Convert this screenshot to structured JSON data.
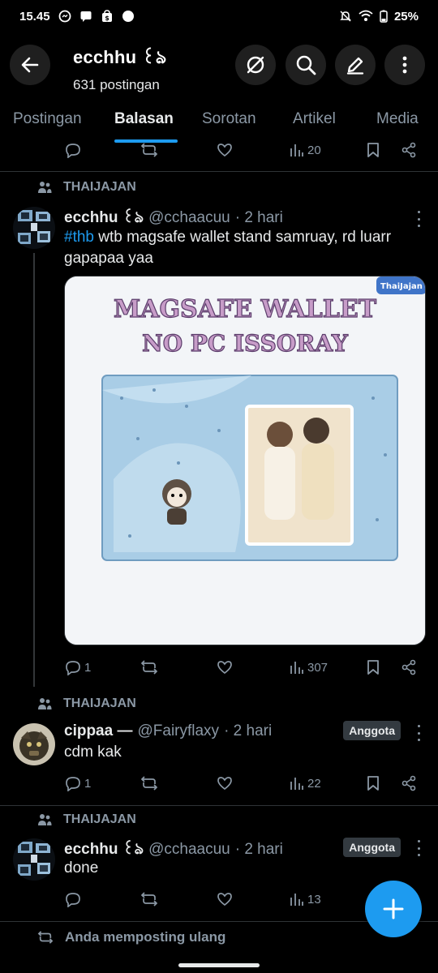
{
  "status_bar": {
    "time": "15.45",
    "battery": "25%"
  },
  "header": {
    "title": "ecchhu ꒰ঌ",
    "subtitle": "631 postingan"
  },
  "tabs": [
    {
      "label": "Postingan"
    },
    {
      "label": "Balasan"
    },
    {
      "label": "Sorotan"
    },
    {
      "label": "Artikel"
    },
    {
      "label": "Media"
    }
  ],
  "active_tab": "Balasan",
  "prev_post_actions": {
    "views": "20"
  },
  "posts": [
    {
      "context": "THAIJAJAN",
      "name": "ecchhu ꒰ঌ",
      "handle": "@cchaacuu",
      "time": "· 2 hari",
      "hashtag": "#thb",
      "text": " wtb magsafe wallet stand samruay, rd luarr gapapaa yaa",
      "media": {
        "title_line1": "MAGSAFE WALLET",
        "title_line2": "NO PC ISSORAY",
        "corner_label": "ThaiJajan"
      },
      "replies": "1",
      "views": "307"
    },
    {
      "context": "THAIJAJAN",
      "name": "cippaa —",
      "handle": "@Fairyflaxy",
      "time": "· 2 hari",
      "badge": "Anggota",
      "text": "cdm kak",
      "replies": "1",
      "views": "22"
    },
    {
      "context": "THAIJAJAN",
      "name": "ecchhu ꒰ঌ",
      "handle": "@cchaacuu",
      "time": "· 2 hari",
      "badge": "Anggota",
      "text": "done",
      "views": "13"
    }
  ],
  "repost_note": "Anda memposting ulang",
  "colors": {
    "accent": "#1d9bf0",
    "background": "#000000",
    "muted": "#8b98a5"
  }
}
